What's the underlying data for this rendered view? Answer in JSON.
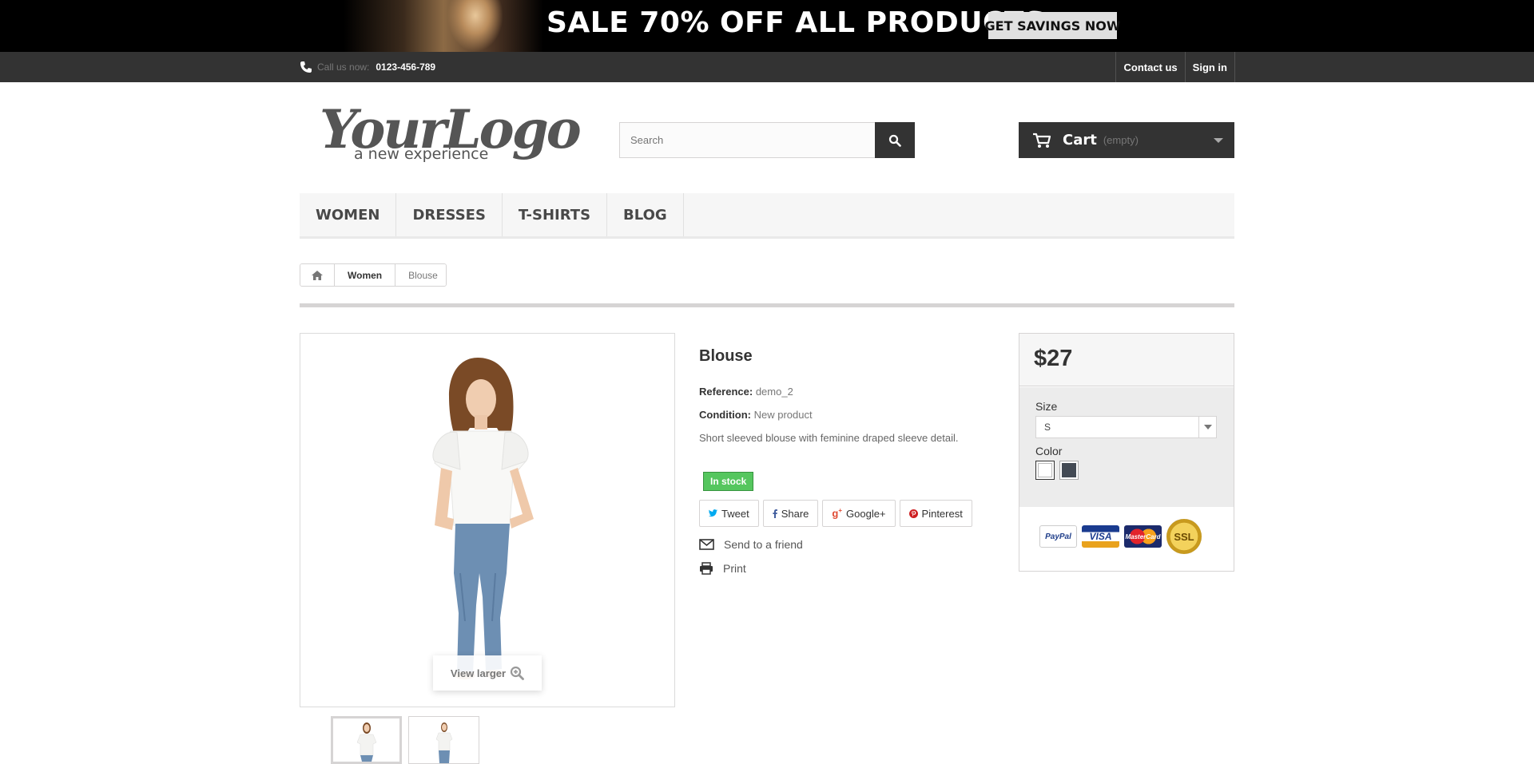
{
  "banner": {
    "headline": "SALE 70% OFF ALL PRODUCTS",
    "button_label": "GET SAVINGS NOW"
  },
  "topbar": {
    "call_label": "Call us now:",
    "phone": "0123-456-789",
    "links": [
      "Contact us",
      "Sign in"
    ]
  },
  "header": {
    "logo_main": "YourLogo",
    "logo_tagline": "a new experience",
    "search_placeholder": "Search",
    "cart_label": "Cart",
    "cart_status": "(empty)"
  },
  "menu": {
    "items": [
      "WOMEN",
      "DRESSES",
      "T-SHIRTS",
      "BLOG"
    ]
  },
  "breadcrumb": {
    "items": [
      "Women",
      "Blouse"
    ]
  },
  "product": {
    "view_larger_label": "View larger",
    "title": "Blouse",
    "reference_label": "Reference:",
    "reference_value": "demo_2",
    "condition_label": "Condition:",
    "condition_value": "New product",
    "short_description": "Short sleeved blouse with feminine draped sleeve detail.",
    "stock_status": "In stock",
    "social": [
      "Tweet",
      "Share",
      "Google+",
      "Pinterest"
    ],
    "send_to_friend": "Send to a friend",
    "print": "Print"
  },
  "buybox": {
    "price": "$27",
    "size_label": "Size",
    "size_selected": "S",
    "color_label": "Color",
    "colors": [
      "#ffffff",
      "#434a54"
    ],
    "payment_cards": [
      "PayPal",
      "VISA",
      "MasterCard",
      "SSL"
    ]
  },
  "colors": {
    "dark_bar": "#333333",
    "stock_green": "#55c65e",
    "divider": "#d6d4d4"
  }
}
